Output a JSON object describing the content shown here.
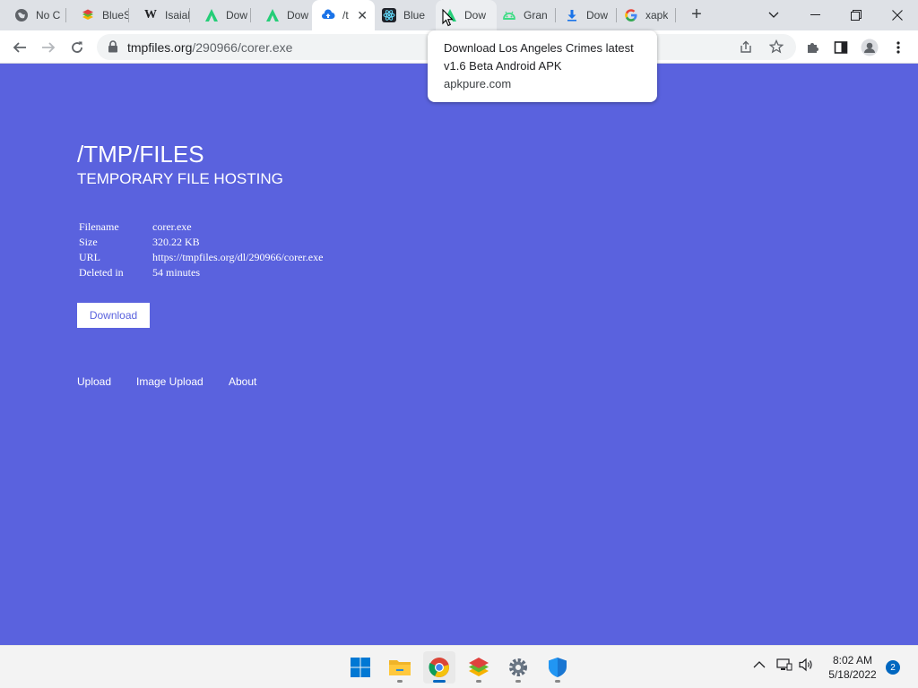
{
  "browser": {
    "tabs": [
      {
        "title": "No C",
        "icon": "globe-icon"
      },
      {
        "title": "BlueS",
        "icon": "bluestacks-icon"
      },
      {
        "title": "Isaiah",
        "icon": "wikipedia-icon"
      },
      {
        "title": "Dow",
        "icon": "apkpure-icon"
      },
      {
        "title": "Dow",
        "icon": "apkpure-icon"
      },
      {
        "title": "/t",
        "icon": "cloud-upload-icon",
        "active": true
      },
      {
        "title": "Blue",
        "icon": "react-icon"
      },
      {
        "title": "Dow",
        "icon": "apkpure-icon"
      },
      {
        "title": "Gran",
        "icon": "android-icon"
      },
      {
        "title": "Dow",
        "icon": "download-icon"
      },
      {
        "title": "xapk",
        "icon": "google-icon"
      }
    ],
    "url_domain": "tmpfiles.org",
    "url_path": "/290966/corer.exe"
  },
  "tooltip": {
    "title": "Download Los Angeles Crimes latest v1.6 Beta Android APK",
    "domain": "apkpure.com"
  },
  "page": {
    "title": "/TMP/FILES",
    "subtitle": "TEMPORARY FILE HOSTING",
    "file_info": [
      {
        "label": "Filename",
        "value": "corer.exe"
      },
      {
        "label": "Size",
        "value": "320.22 KB"
      },
      {
        "label": "URL",
        "value": "https://tmpfiles.org/dl/290966/corer.exe"
      },
      {
        "label": "Deleted in",
        "value": "54 minutes"
      }
    ],
    "download_label": "Download",
    "footer_links": [
      "Upload",
      "Image Upload",
      "About"
    ]
  },
  "colors": {
    "page_bg": "#5a62de",
    "accent_blue": "#0067c0"
  },
  "taskbar": {
    "time": "8:02 AM",
    "date": "5/18/2022",
    "notification_count": "2"
  }
}
